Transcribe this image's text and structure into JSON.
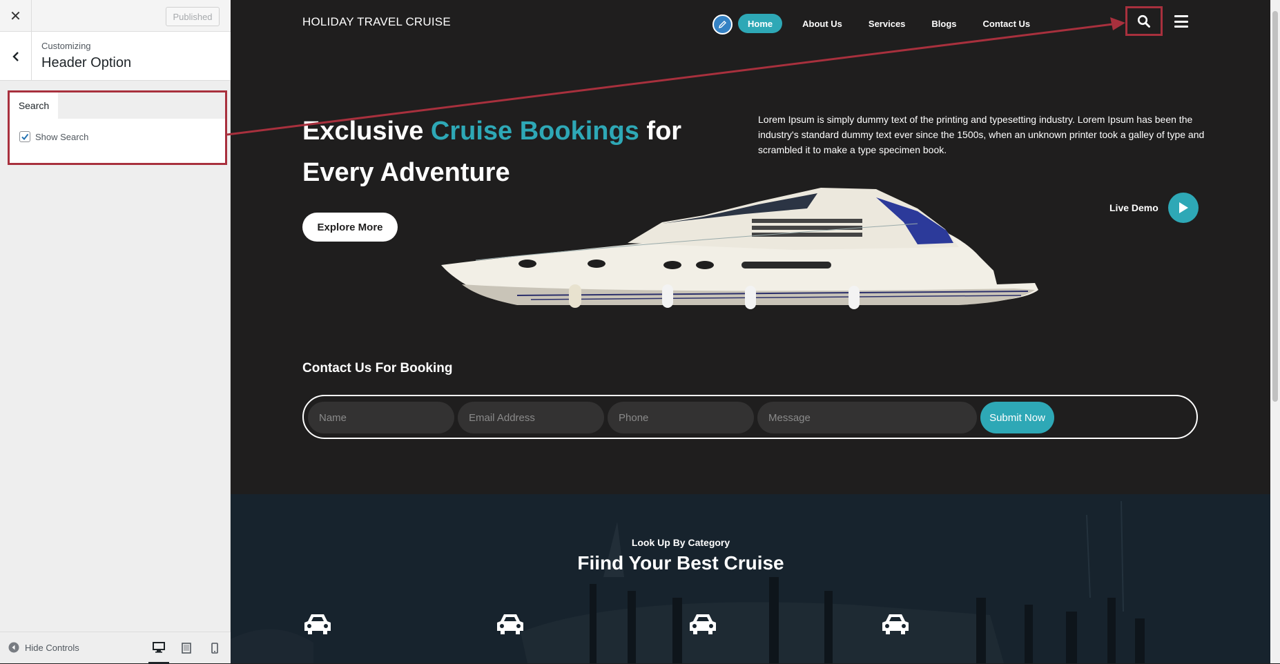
{
  "customizer": {
    "close_label": "✕",
    "published_label": "Published",
    "caption": "Customizing",
    "title": "Header Option",
    "section_tab": "Search",
    "show_search_label": "Show Search",
    "show_search_checked": true,
    "hide_controls_label": "Hide Controls",
    "devices": [
      "desktop-icon",
      "tablet-icon",
      "mobile-icon"
    ]
  },
  "site": {
    "title": "HOLIDAY TRAVEL CRUISE",
    "nav": [
      {
        "label": "Home",
        "active": true
      },
      {
        "label": "About Us",
        "active": false
      },
      {
        "label": "Services",
        "active": false
      },
      {
        "label": "Blogs",
        "active": false
      },
      {
        "label": "Contact Us",
        "active": false
      }
    ],
    "accent_color": "#2ea8b6",
    "annotation_color": "#a8303d"
  },
  "hero": {
    "heading_pre": "Exclusive ",
    "heading_accent": "Cruise Bookings",
    "heading_post": " for Every Adventure",
    "description": "Lorem Ipsum is simply dummy text of the printing and typesetting industry. Lorem Ipsum has been the industry's standard dummy text ever since the 1500s, when an unknown printer took a galley of type and scrambled it to make a type specimen book.",
    "explore_label": "Explore More",
    "live_demo_label": "Live Demo"
  },
  "booking": {
    "title": "Contact Us For Booking",
    "fields": {
      "name": "Name",
      "email": "Email Address",
      "phone": "Phone",
      "message": "Message"
    },
    "submit_label": "Submit Now"
  },
  "category": {
    "eyebrow": "Look Up By Category",
    "heading": "Fiind Your Best Cruise",
    "icons": [
      "car-icon",
      "car-icon",
      "car-icon",
      "car-icon"
    ]
  }
}
